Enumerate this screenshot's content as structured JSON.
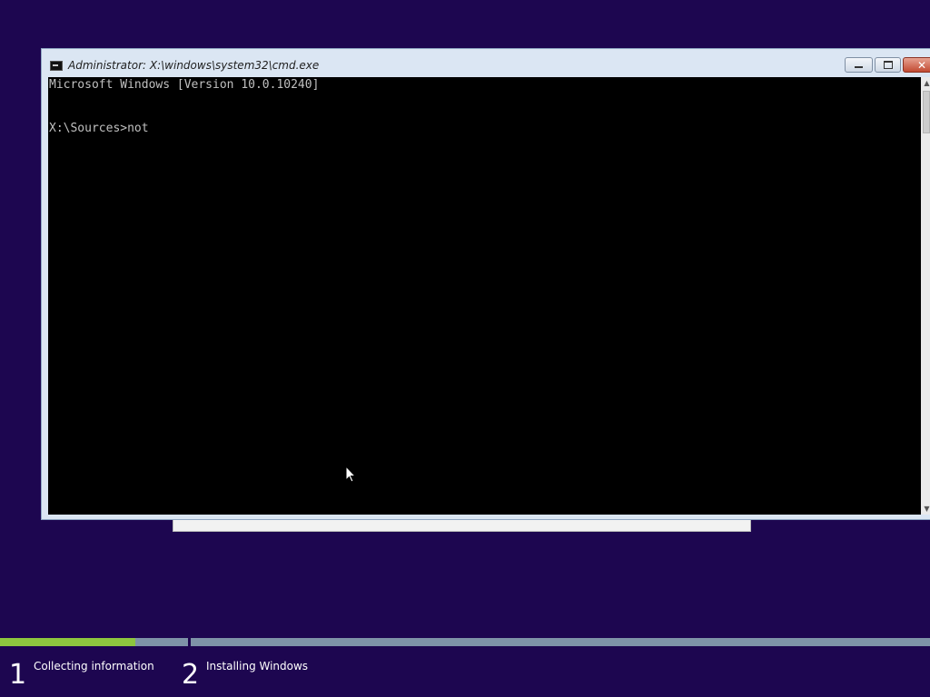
{
  "window": {
    "title": "Administrator: X:\\windows\\system32\\cmd.exe",
    "icon": "console-icon",
    "controls": {
      "minimize_icon": "minimize-icon",
      "maximize_icon": "maximize-icon",
      "close_label": "✕"
    }
  },
  "console": {
    "lines": [
      "Microsoft Windows [Version 10.0.10240]",
      "X:\\Sources>not"
    ],
    "colors": {
      "background": "#000000",
      "text": "#c0c0c0"
    }
  },
  "scrollbar": {
    "up_arrow": "▲",
    "down_arrow": "▼"
  },
  "setup": {
    "background_color": "#1d0650",
    "progress_color": "#8dc63f",
    "steps": [
      {
        "number": "1",
        "label": "Collecting information",
        "progress": 0.72
      },
      {
        "number": "2",
        "label": "Installing Windows",
        "progress": 0
      }
    ]
  }
}
